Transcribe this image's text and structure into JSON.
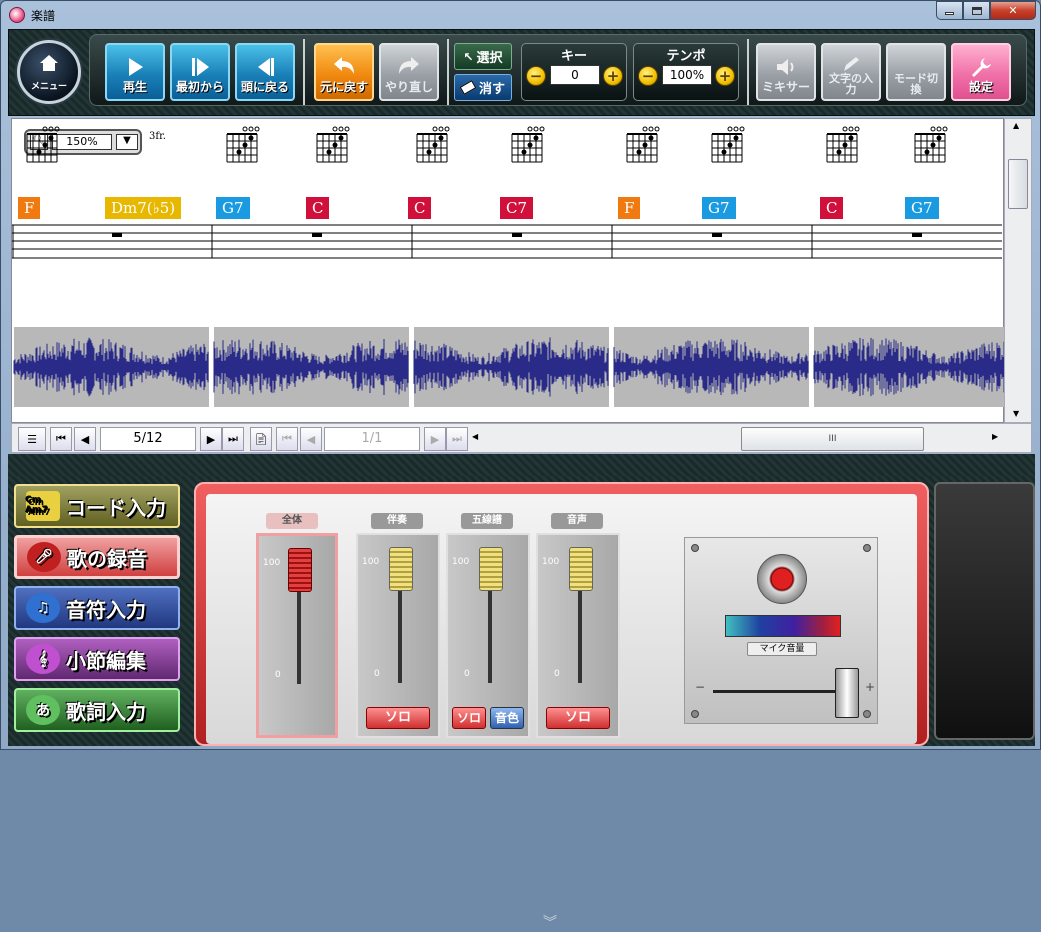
{
  "window": {
    "title": "楽譜",
    "close_symbol": "✕"
  },
  "toolbar": {
    "menu_label": "メニュー",
    "play": "再生",
    "from_start": "最初から",
    "to_head": "頭に戻る",
    "undo": "元に戻す",
    "redo": "やり直し",
    "select": "選択",
    "erase": "消す",
    "key_title": "キー",
    "key_value": "0",
    "tempo_title": "テンポ",
    "tempo_value": "100%",
    "mixer": "ミキサー",
    "text_input": "文字の入力",
    "mode_switch": "モード切換",
    "settings": "設定"
  },
  "score": {
    "zoom": "150%",
    "fret_marker": "3fr.",
    "chords": [
      {
        "name": "F",
        "color": "#f07a10"
      },
      {
        "name": "Dm7(♭5)",
        "color": "#e8b800"
      },
      {
        "name": "G7",
        "color": "#1a9ae0"
      },
      {
        "name": "C",
        "color": "#d0103a"
      },
      {
        "name": "C",
        "color": "#d0103a"
      },
      {
        "name": "C7",
        "color": "#d0103a"
      },
      {
        "name": "F",
        "color": "#f07a10"
      },
      {
        "name": "G7",
        "color": "#1a9ae0"
      },
      {
        "name": "C",
        "color": "#d0103a"
      },
      {
        "name": "G7",
        "color": "#1a9ae0"
      }
    ]
  },
  "nav": {
    "page": "5/12",
    "subpage": "1/1",
    "hscroll_grip": "III"
  },
  "side": {
    "chord_input": "コード入力",
    "chord_icon": "Cm Am7",
    "song_record": "歌の録音",
    "note_input": "音符入力",
    "bar_edit": "小節編集",
    "lyric_input": "歌詞入力",
    "lyric_icon": "あ"
  },
  "mixer": {
    "channels": [
      {
        "label": "全体"
      },
      {
        "label": "伴奏"
      },
      {
        "label": "五線譜"
      },
      {
        "label": "音声"
      }
    ],
    "tick_100": "100",
    "tick_0": "0",
    "solo": "ソロ",
    "timbre": "音色",
    "mic_volume": "マイク音量",
    "minus": "−",
    "plus": "+"
  }
}
